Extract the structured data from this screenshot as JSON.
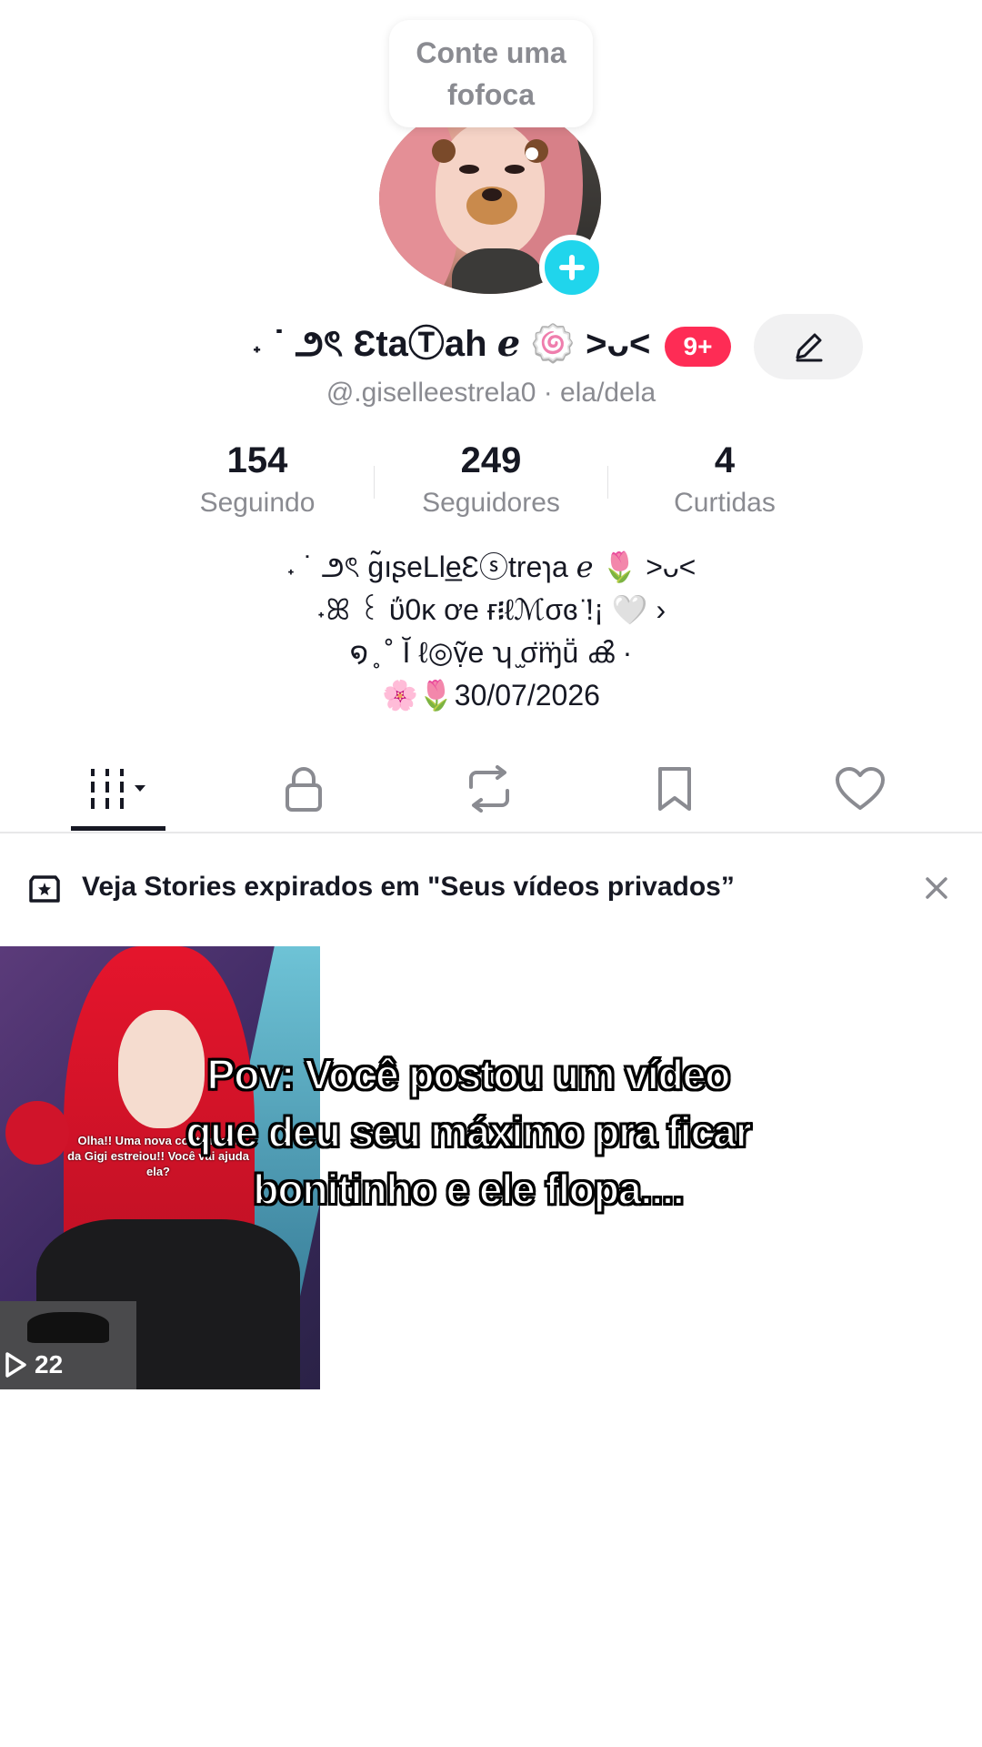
{
  "profile": {
    "bubble_text": "Conte uma fofoca",
    "display_name": "˖ ˙ ౨ৎ ƐtaⓉah ℯ 🍥 >ᴗ<",
    "notifications_badge": "9+",
    "username": "@.giselleestrela0 · ela/dela"
  },
  "stats": [
    {
      "value": "154",
      "label": "Seguindo"
    },
    {
      "value": "249",
      "label": "Seguidores"
    },
    {
      "value": "4",
      "label": "Curtidas"
    }
  ],
  "bio": {
    "line1": "˖ ˙ ౨ৎ ɡ̃ıʂeLle̲Ɛⓢtreɿa ℯ 🌷 >ᴗ<",
    "line2": "˖ꕤ ꒰ ΰ0ĸ ơe ғ᎒ℓℳσɞ ̈!¡ 🤍 ›",
    "line3": "໑ ̥ ˚ Ĭ ℓ◎ṿ̃e ʮ ̫σ̈ɱ̈ṻ ൿ ·",
    "line4": "🌸🌷30/07/2026"
  },
  "tabs": [
    {
      "icon": "videos-grid-icon"
    },
    {
      "icon": "lock-icon"
    },
    {
      "icon": "repost-icon"
    },
    {
      "icon": "bookmark-icon"
    },
    {
      "icon": "heart-icon"
    }
  ],
  "banner": {
    "text": "Veja Stories expirados em \"Seus vídeos privados”"
  },
  "video": {
    "views": "22",
    "overlay_line1": "Olha!! Uma nova conta moot",
    "overlay_line2": "da Gigi estreiou!! Você vai ajuda",
    "overlay_line3": "ela?"
  },
  "caption": {
    "line1": "Pov: Você postou um vídeo",
    "line2": "que deu seu máximo pra ficar",
    "line3": "bonitinho e ele flopa...."
  },
  "colors": {
    "accent_pink": "#fe2c55",
    "accent_cyan": "#20d5ec",
    "text_primary": "#161823",
    "text_secondary": "#8a8b91"
  }
}
